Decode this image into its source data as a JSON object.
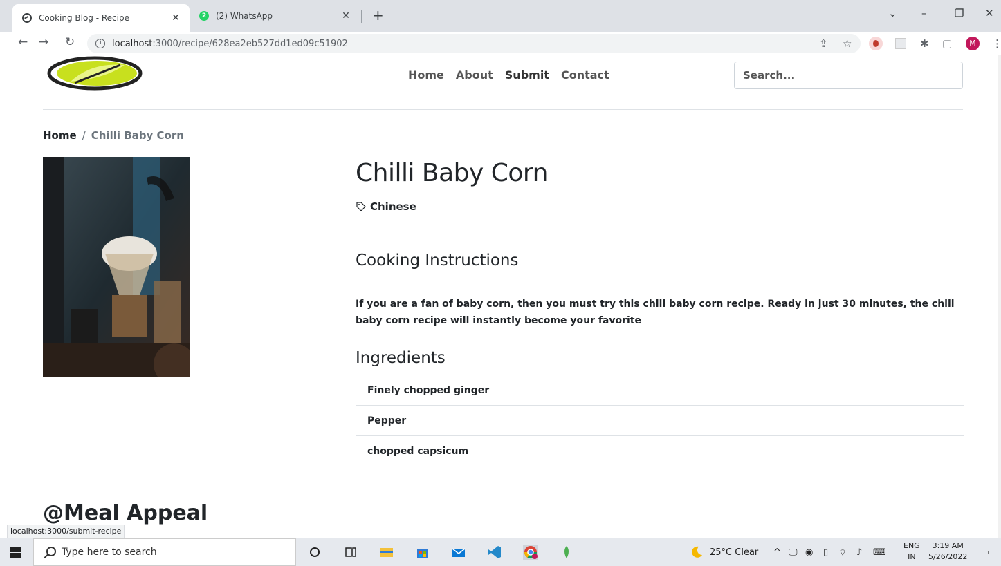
{
  "browser": {
    "tabs": [
      {
        "title": "Cooking Blog - Recipe",
        "active": true
      },
      {
        "title": "(2) WhatsApp",
        "badge": "2",
        "active": false
      }
    ],
    "url_host": "localhost",
    "url_path": ":3000/recipe/628ea2eb527dd1ed09c51902",
    "profile_initial": "M",
    "status_tooltip": "localhost:3000/submit-recipe"
  },
  "site": {
    "nav": [
      "Home",
      "About",
      "Submit",
      "Contact"
    ],
    "search_placeholder": "Search...",
    "footer_brand": "@Meal Appeal"
  },
  "breadcrumb": {
    "home": "Home",
    "separator": "/",
    "current": "Chilli Baby Corn"
  },
  "recipe": {
    "title": "Chilli Baby Corn",
    "category": "Chinese",
    "instructions_heading": "Cooking Instructions",
    "instructions": "If you are a fan of baby corn, then you must try this chili baby corn recipe. Ready in just 30 minutes, the chili baby corn recipe will instantly become your favorite",
    "ingredients_heading": "Ingredients",
    "ingredients": [
      "Finely chopped ginger",
      "Pepper",
      "chopped capsicum"
    ]
  },
  "taskbar": {
    "search_placeholder": "Type here to search",
    "weather": "25°C  Clear",
    "lang_top": "ENG",
    "lang_bottom": "IN",
    "time": "3:19 AM",
    "date": "5/26/2022"
  },
  "colors": {
    "accent_green": "#c8e01e",
    "whatsapp_green": "#25d366",
    "profile": "#c2185b"
  }
}
